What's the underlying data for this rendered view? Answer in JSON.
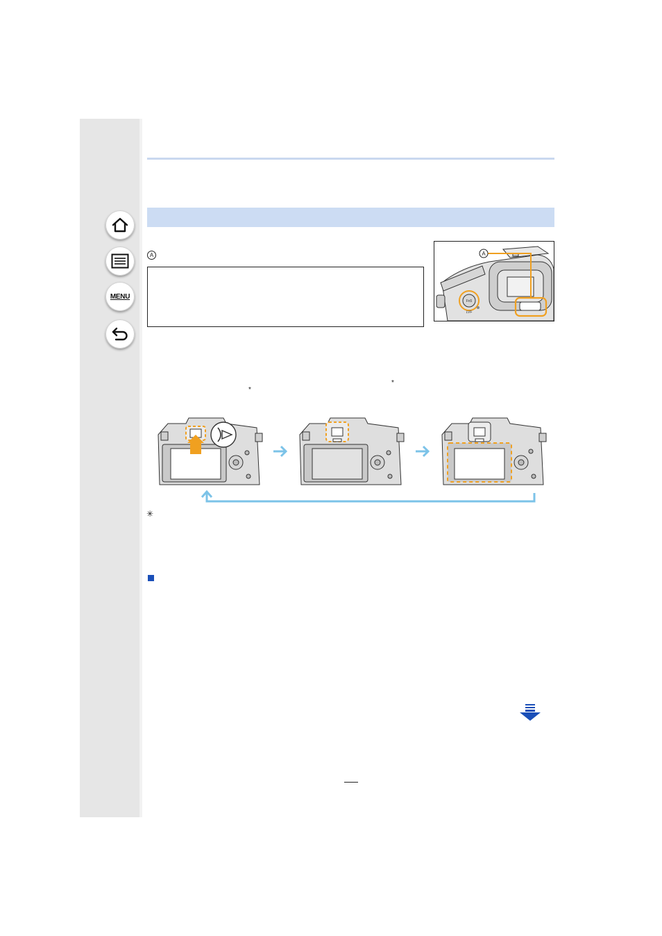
{
  "sidebar": {
    "buttons": [
      {
        "name": "home",
        "icon": "home-icon"
      },
      {
        "name": "contents",
        "icon": "list-icon"
      },
      {
        "name": "menu",
        "icon": "menu-icon",
        "label": "MENU"
      },
      {
        "name": "back",
        "icon": "return-icon"
      }
    ]
  },
  "camera_closeup": {
    "callout": "A",
    "dial_label": "LVF",
    "fn_label": "Fn5"
  },
  "legend_marker": "Ⓐ",
  "asterisks": {
    "mark": "*"
  },
  "footnote_marker": "✳",
  "colors": {
    "accent_blue": "#1a4fb8",
    "band_blue": "#ccdcf3",
    "flow_arrow": "#7cc3e8",
    "highlight_orange": "#f0a020"
  }
}
